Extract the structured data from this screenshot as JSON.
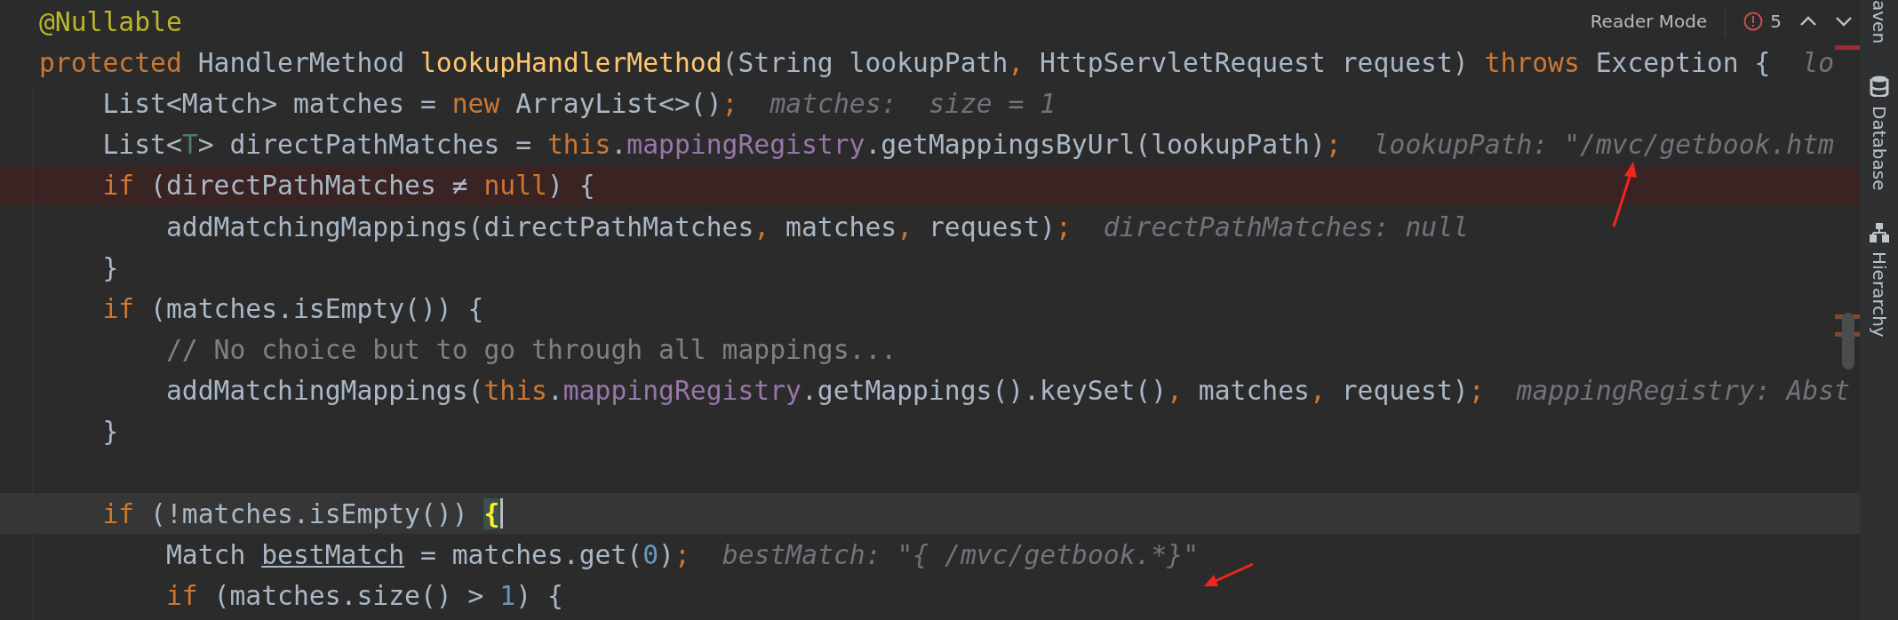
{
  "toolbar": {
    "reader_mode": "Reader Mode",
    "problems_count": "5"
  },
  "lines": [
    {
      "breakpoint": false,
      "caret_line": false,
      "tokens": [
        {
          "kind": "annotation",
          "text": "@Nullable"
        }
      ]
    },
    {
      "breakpoint": false,
      "caret_line": false,
      "tokens": [
        {
          "kind": "keyword",
          "text": "protected"
        },
        {
          "kind": "plain",
          "text": " HandlerMethod "
        },
        {
          "kind": "method",
          "text": "lookupHandlerMethod"
        },
        {
          "kind": "plain",
          "text": "(String lookupPath"
        },
        {
          "kind": "keyword",
          "text": ","
        },
        {
          "kind": "plain",
          "text": " HttpServletRequest request) "
        },
        {
          "kind": "keyword",
          "text": "throws"
        },
        {
          "kind": "plain",
          "text": " Exception {"
        }
      ],
      "hint": "lo"
    },
    {
      "breakpoint": false,
      "caret_line": false,
      "tokens": [
        {
          "kind": "plain",
          "text": "    List<Match> matches = "
        },
        {
          "kind": "keyword",
          "text": "new"
        },
        {
          "kind": "plain",
          "text": " ArrayList<>()"
        },
        {
          "kind": "keyword",
          "text": ";"
        }
      ],
      "hint": "matches:  size = 1"
    },
    {
      "breakpoint": false,
      "caret_line": false,
      "tokens": [
        {
          "kind": "plain",
          "text": "    List<"
        },
        {
          "kind": "type-param",
          "text": "T"
        },
        {
          "kind": "plain",
          "text": "> directPathMatches = "
        },
        {
          "kind": "keyword",
          "text": "this"
        },
        {
          "kind": "plain",
          "text": "."
        },
        {
          "kind": "field",
          "text": "mappingRegistry"
        },
        {
          "kind": "plain",
          "text": ".getMappingsByUrl(lookupPath)"
        },
        {
          "kind": "keyword",
          "text": ";"
        }
      ],
      "hint": "lookupPath: \"/mvc/getbook.htm"
    },
    {
      "breakpoint": true,
      "caret_line": false,
      "tokens": [
        {
          "kind": "keyword",
          "text": "    if"
        },
        {
          "kind": "plain",
          "text": " (directPathMatches ≠ "
        },
        {
          "kind": "keyword",
          "text": "null"
        },
        {
          "kind": "plain",
          "text": ") {"
        }
      ]
    },
    {
      "breakpoint": false,
      "caret_line": false,
      "tokens": [
        {
          "kind": "plain",
          "text": "        addMatchingMappings(directPathMatches"
        },
        {
          "kind": "keyword",
          "text": ","
        },
        {
          "kind": "plain",
          "text": " matches"
        },
        {
          "kind": "keyword",
          "text": ","
        },
        {
          "kind": "plain",
          "text": " request)"
        },
        {
          "kind": "keyword",
          "text": ";"
        }
      ],
      "hint": "directPathMatches: null"
    },
    {
      "breakpoint": false,
      "caret_line": false,
      "tokens": [
        {
          "kind": "plain",
          "text": "    }"
        }
      ]
    },
    {
      "breakpoint": false,
      "caret_line": false,
      "tokens": [
        {
          "kind": "keyword",
          "text": "    if"
        },
        {
          "kind": "plain",
          "text": " (matches.isEmpty()) {"
        }
      ]
    },
    {
      "breakpoint": false,
      "caret_line": false,
      "tokens": [
        {
          "kind": "comment",
          "text": "        // No choice but to go through all mappings..."
        }
      ]
    },
    {
      "breakpoint": false,
      "caret_line": false,
      "tokens": [
        {
          "kind": "plain",
          "text": "        addMatchingMappings("
        },
        {
          "kind": "keyword",
          "text": "this"
        },
        {
          "kind": "plain",
          "text": "."
        },
        {
          "kind": "field",
          "text": "mappingRegistry"
        },
        {
          "kind": "plain",
          "text": ".getMappings().keySet()"
        },
        {
          "kind": "keyword",
          "text": ","
        },
        {
          "kind": "plain",
          "text": " matches"
        },
        {
          "kind": "keyword",
          "text": ","
        },
        {
          "kind": "plain",
          "text": " request)"
        },
        {
          "kind": "keyword",
          "text": ";"
        }
      ],
      "hint": "mappingRegistry: Abst"
    },
    {
      "breakpoint": false,
      "caret_line": false,
      "tokens": [
        {
          "kind": "plain",
          "text": "    }"
        }
      ]
    },
    {
      "breakpoint": false,
      "caret_line": false
    },
    {
      "breakpoint": false,
      "caret_line": true,
      "tokens": [
        {
          "kind": "keyword",
          "text": "    if"
        },
        {
          "kind": "plain",
          "text": " (!matches.isEmpty()) "
        },
        {
          "kind": "brace-match",
          "text": "{"
        }
      ]
    },
    {
      "breakpoint": false,
      "caret_line": false,
      "tokens": [
        {
          "kind": "plain",
          "text": "        Match "
        },
        {
          "kind": "underlined",
          "text": "bestMatch"
        },
        {
          "kind": "plain",
          "text": " = matches.get("
        },
        {
          "kind": "number",
          "text": "0"
        },
        {
          "kind": "plain",
          "text": ")"
        },
        {
          "kind": "keyword",
          "text": ";"
        }
      ],
      "hint": "bestMatch: \"{ /mvc/getbook.*}\""
    },
    {
      "breakpoint": false,
      "caret_line": false,
      "tokens": [
        {
          "kind": "keyword",
          "text": "        if"
        },
        {
          "kind": "plain",
          "text": " (matches.size() > "
        },
        {
          "kind": "number",
          "text": "1"
        },
        {
          "kind": "plain",
          "text": ") {"
        }
      ]
    }
  ],
  "tool_windows": [
    "aven",
    "Database",
    "Hierarchy"
  ]
}
